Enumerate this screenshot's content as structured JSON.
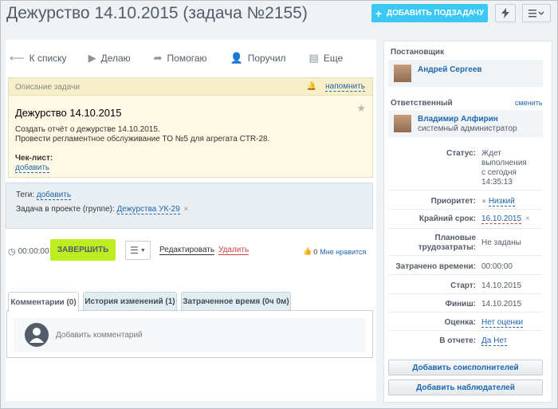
{
  "header": {
    "title": "Дежурство 14.10.2015 (задача №2155)",
    "add_subtask_label": "ДОБАВИТЬ ПОДЗАДАЧУ",
    "accent_color": "#3bc8f5"
  },
  "toolbar": {
    "back": "К списку",
    "doing": "Делаю",
    "helping": "Помогаю",
    "delegated": "Поручил",
    "more": "Еще"
  },
  "description": {
    "header": "Описание задачи",
    "remind": "напомнить",
    "task_title": "Дежурство 14.10.2015",
    "lines": [
      "Создать отчёт о дежурстве 14.10.2015.",
      "Провести регламентное обслуживание ТО №5 для агрегата CTR-28."
    ],
    "checklist_label": "Чек-лист:",
    "checklist_add": "добавить"
  },
  "tags": {
    "label": "Теги:",
    "add": "добавить",
    "project_label": "Задача в проекте (группе):",
    "project_value": "Дежурства УК-29"
  },
  "actions": {
    "timer": "00:00:00",
    "finish": "ЗАВЕРШИТЬ",
    "finish_color": "#bbed21",
    "edit": "Редактировать",
    "delete": "Удалить",
    "likes_count": "0",
    "likes_label": "Мне нравится"
  },
  "tabs": [
    {
      "label": "Комментарии (0)",
      "active": true
    },
    {
      "label": "История изменений (1)",
      "active": false
    },
    {
      "label": "Затраченное время (0ч 0м)",
      "active": false
    }
  ],
  "comments": {
    "placeholder": "Добавить комментарий"
  },
  "sidebar": {
    "creator_title": "Постановщик",
    "creator_name": "Андрей Сергеев",
    "responsible_title": "Ответственный",
    "change_link": "сменить",
    "responsible_name": "Владимир Алфирин",
    "responsible_role": "системный администратор",
    "status_label": "Статус:",
    "status_lines": [
      "Ждет",
      "выполнения",
      "с сегодня",
      "14:35:13"
    ],
    "priority_label": "Приоритет:",
    "priority_value": "Низкий",
    "deadline_label": "Крайний срок:",
    "deadline_value": "16.10.2015",
    "planned_label_1": "Плановые",
    "planned_label_2": "трудозатраты:",
    "planned_value": "Не заданы",
    "spent_label": "Затрачено времени:",
    "spent_value": "00:00:00",
    "start_label": "Старт:",
    "start_value": "14.10.2015",
    "finish_label": "Финиш:",
    "finish_value": "14.10.2015",
    "rating_label": "Оценка:",
    "rating_value": "Нет оценки",
    "report_label": "В отчете:",
    "report_yes": "Да",
    "report_no": "Нет",
    "add_coexecutors": "Добавить соисполнителей",
    "add_observers": "Добавить наблюдателей"
  }
}
